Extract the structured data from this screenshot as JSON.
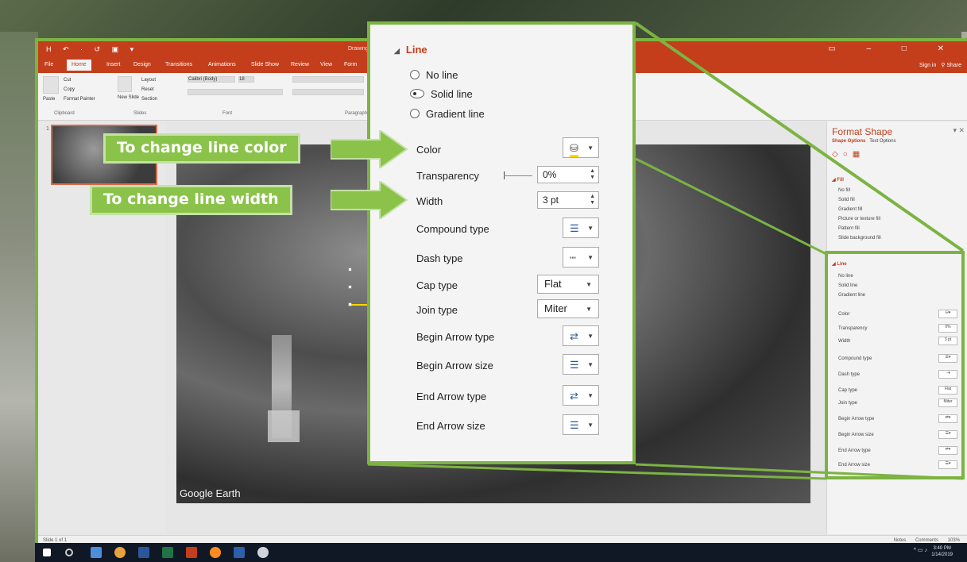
{
  "powerpoint": {
    "quick_access": "H ↶ · ↺ ▣ ▾",
    "doc_title": "Drawing",
    "window_controls": "▭ – □ ✕",
    "tabs": [
      "File",
      "Home",
      "Insert",
      "Design",
      "Transitions",
      "Animations",
      "Slide Show",
      "Review",
      "View",
      "Form"
    ],
    "active_tab": "Home",
    "sign_in": "Sign in",
    "share": "Share",
    "ribbon": {
      "clipboard": {
        "paste": "Paste",
        "cut": "Cut",
        "copy": "Copy",
        "format_painter": "Format Painter",
        "label": "Clipboard"
      },
      "slides": {
        "new_slide": "New Slide",
        "layout": "Layout",
        "reset": "Reset",
        "section": "Section",
        "label": "Slides"
      },
      "font": {
        "font_name": "Calibri (Body)",
        "font_size": "18",
        "label": "Font"
      },
      "paragraph": {
        "label": "Paragraph"
      }
    },
    "slide_number": "1",
    "watermark": "Google Earth",
    "format_pane": {
      "title": "Format Shape",
      "tab_shape": "Shape Options",
      "tab_text": "Text Options",
      "fill_section": "Fill",
      "fill_options": [
        "No fill",
        "Solid fill",
        "Gradient fill",
        "Picture or texture fill",
        "Pattern fill",
        "Slide background fill"
      ],
      "line_section": "Line",
      "line_options": [
        "No line",
        "Solid line",
        "Gradient line"
      ],
      "rows": [
        {
          "label": "Color",
          "value": ""
        },
        {
          "label": "Transparency",
          "value": "0%"
        },
        {
          "label": "Width",
          "value": "3 pt"
        },
        {
          "label": "Compound type",
          "value": ""
        },
        {
          "label": "Dash type",
          "value": ""
        },
        {
          "label": "Cap type",
          "value": "Flat"
        },
        {
          "label": "Join type",
          "value": "Miter"
        },
        {
          "label": "Begin Arrow type",
          "value": ""
        },
        {
          "label": "Begin Arrow size",
          "value": ""
        },
        {
          "label": "End Arrow type",
          "value": ""
        },
        {
          "label": "End Arrow size",
          "value": ""
        }
      ]
    },
    "status": {
      "slide_of": "Slide 1 of 1",
      "notes": "Notes",
      "comments": "Comments",
      "zoom": "103%"
    }
  },
  "callout": {
    "section": "Line",
    "radios": {
      "no_line": "No line",
      "solid_line": "Solid line",
      "gradient_line": "Gradient line",
      "selected": "Solid line"
    },
    "color": "Color",
    "transparency": "Transparency",
    "transparency_value": "0%",
    "width": "Width",
    "width_value": "3 pt",
    "compound_type": "Compound type",
    "dash_type": "Dash type",
    "cap_type": "Cap type",
    "cap_value": "Flat",
    "join_type": "Join type",
    "join_value": "Miter",
    "begin_arrow_type": "Begin Arrow type",
    "begin_arrow_size": "Begin Arrow size",
    "end_arrow_type": "End Arrow type",
    "end_arrow_size": "End Arrow size"
  },
  "annotations": {
    "color_label": "To change line color",
    "width_label": "To change line width",
    "accent": "#8bc34a"
  },
  "taskbar": {
    "time": "3:40 PM",
    "date": "1/14/2019"
  },
  "colors": {
    "ppt_orange": "#c43e1c",
    "highlight_green": "#7cb342",
    "line_yellow": "#ffd400"
  }
}
